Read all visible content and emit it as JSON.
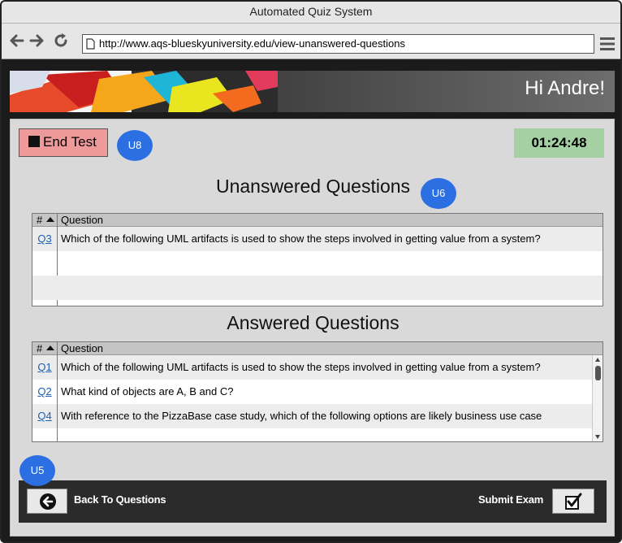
{
  "window": {
    "title": "Automated Quiz System"
  },
  "browser": {
    "url": "http://www.aqs-blueskyuniversity.edu/view-unanswered-questions"
  },
  "header": {
    "greeting": "Hi Andre!"
  },
  "controls": {
    "end_test_label": "End Test",
    "timer": "01:24:48"
  },
  "badges": {
    "u8": "U8",
    "u6": "U6",
    "u5": "U5"
  },
  "unanswered": {
    "title": "Unanswered Questions",
    "headers": {
      "num": "#",
      "question": "Question"
    },
    "rows": [
      {
        "num": "Q3",
        "question": "Which of the following UML artifacts is used to show the steps involved in getting value from a system?"
      }
    ]
  },
  "answered": {
    "title": "Answered Questions",
    "headers": {
      "num": "#",
      "question": "Question"
    },
    "rows": [
      {
        "num": "Q1",
        "question": "Which of the following UML artifacts is used to show the steps involved in getting value from a system?"
      },
      {
        "num": "Q2",
        "question": "What kind of objects are A, B and C?"
      },
      {
        "num": "Q4",
        "question": "With reference to the PizzaBase case study, which of the following options are likely business use case"
      }
    ]
  },
  "footer": {
    "back_label": "Back To Questions",
    "submit_label": "Submit Exam"
  },
  "colors": {
    "end_test_bg": "#ef9a9a",
    "timer_bg": "#a4d0a4",
    "badge": "#2b6fe3",
    "link": "#1f5fb0"
  },
  "icons": [
    "back-arrow-icon",
    "forward-arrow-icon",
    "reload-icon",
    "page-icon",
    "hamburger-menu-icon",
    "stop-icon",
    "back-circle-arrow-icon",
    "checkbox-check-icon",
    "sort-ascending-icon"
  ]
}
